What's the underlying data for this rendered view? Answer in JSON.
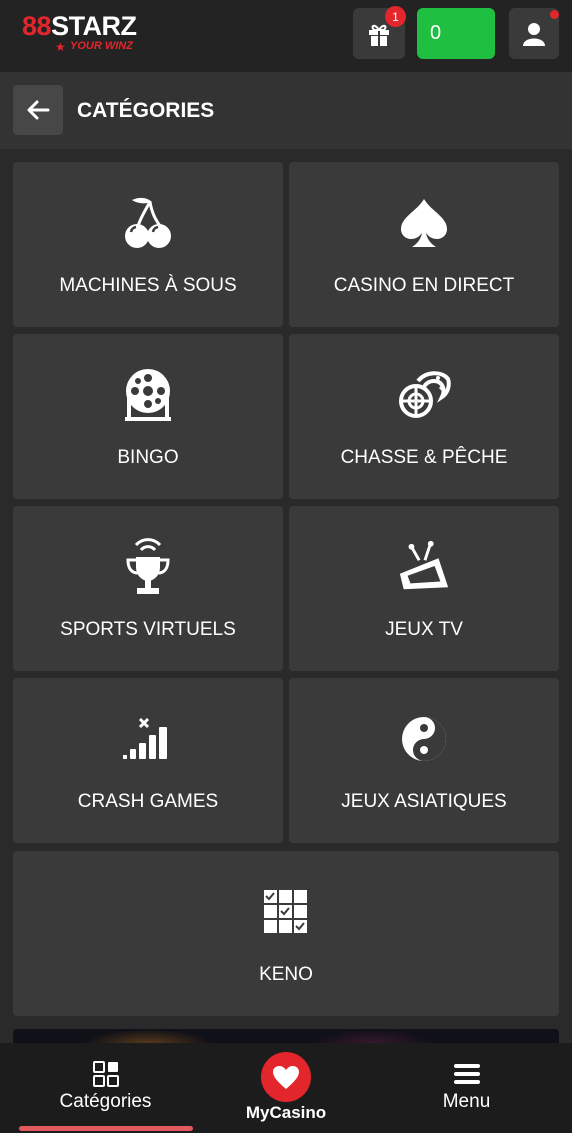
{
  "header": {
    "logo_main_red": "8",
    "logo_main_red2": "8",
    "logo_main_white": "STARZ",
    "logo_tagline": "YOUR WINZ",
    "gift_icon": "gift-icon",
    "gift_badge": "1",
    "balance": "0",
    "user_icon": "user-icon",
    "colors": {
      "accent": "#e2262c",
      "balance": "#1fbf41",
      "bg": "#232323"
    }
  },
  "subheader": {
    "back_icon": "arrow-left-icon",
    "title": "CATÉGORIES"
  },
  "categories": [
    {
      "label": "MACHINES À SOUS",
      "icon": "cherries-icon"
    },
    {
      "label": "CASINO EN DIRECT",
      "icon": "spade-icon"
    },
    {
      "label": "BINGO",
      "icon": "bingo-drum-icon"
    },
    {
      "label": "CHASSE & PÊCHE",
      "icon": "crosshair-fish-icon"
    },
    {
      "label": "SPORTS VIRTUELS",
      "icon": "trophy-broadcast-icon"
    },
    {
      "label": "JEUX TV",
      "icon": "tv-icon"
    },
    {
      "label": "CRASH GAMES",
      "icon": "signal-bars-icon"
    },
    {
      "label": "JEUX ASIATIQUES",
      "icon": "yin-yang-icon"
    },
    {
      "label": "KENO",
      "icon": "keno-grid-icon"
    }
  ],
  "bottom_nav": {
    "categories_label": "Catégories",
    "categories_icon": "grid-icon",
    "mycasino_label": "MyCasino",
    "mycasino_icon": "heart-icon",
    "menu_label": "Menu",
    "menu_icon": "hamburger-icon"
  }
}
